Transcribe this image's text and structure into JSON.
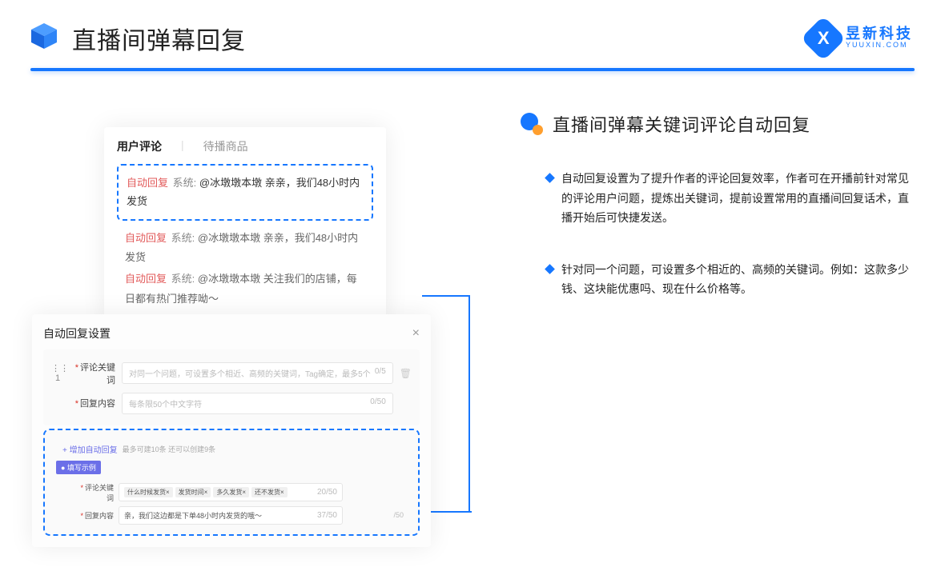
{
  "header": {
    "title": "直播间弹幕回复",
    "logo": {
      "cn": "昱新科技",
      "en": "YUUXIN.COM",
      "letter": "X"
    }
  },
  "comments_panel": {
    "tab_active": "用户评论",
    "tab_inactive": "待播商品",
    "highlighted": {
      "tag": "自动回复",
      "sys": "系统:",
      "text": "@冰墩墩本墩 亲亲，我们48小时内发货"
    },
    "rows": [
      {
        "tag": "自动回复",
        "sys": "系统:",
        "text": "@冰墩墩本墩 亲亲，我们48小时内发货"
      },
      {
        "tag": "自动回复",
        "sys": "系统:",
        "text": "@冰墩墩本墩 关注我们的店铺，每日都有热门推荐呦～"
      }
    ]
  },
  "settings_panel": {
    "title": "自动回复设置",
    "idx": "1",
    "keyword_label": "评论关键词",
    "keyword_placeholder": "对同一个问题，可设置多个相近、高频的关键词，Tag确定，最多5个",
    "keyword_counter": "0/5",
    "content_label": "回复内容",
    "content_placeholder": "每条限50个中文字符",
    "content_counter": "0/50",
    "add_label": "+ 增加自动回复",
    "add_hint": "最多可建10条 还可以创建9条",
    "example": {
      "badge": "● 填写示例",
      "kw_label": "评论关键词",
      "chips": [
        "什么时候发货×",
        "发货时间×",
        "多久发货×",
        "还不发货×"
      ],
      "kw_counter": "20/50",
      "ct_label": "回复内容",
      "ct_text": "亲，我们这边都是下单48小时内发货的哦～",
      "ct_counter": "37/50",
      "outer_counter": "/50"
    }
  },
  "right": {
    "section_title": "直播间弹幕关键词评论自动回复",
    "bullets": [
      "自动回复设置为了提升作者的评论回复效率，作者可在开播前针对常见的评论用户问题，提炼出关键词，提前设置常用的直播间回复话术，直播开始后可快捷发送。",
      "针对同一个问题，可设置多个相近的、高频的关键词。例如：这款多少钱、这块能优惠吗、现在什么价格等。"
    ]
  }
}
